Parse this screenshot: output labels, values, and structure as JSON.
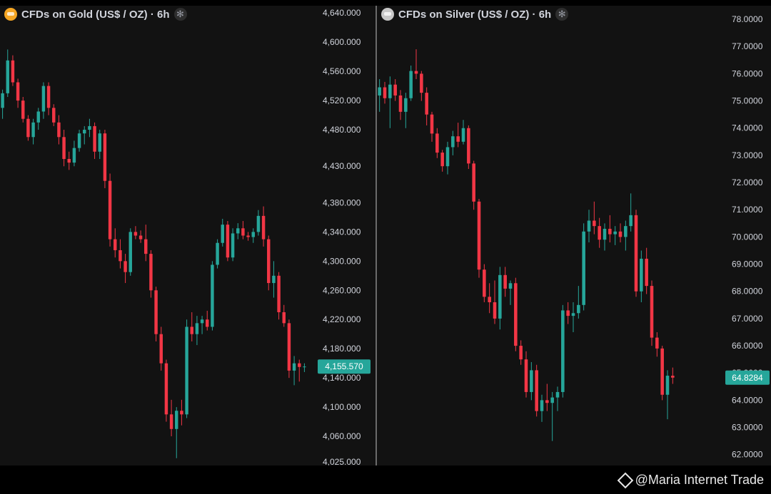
{
  "colors": {
    "up": "#26a69a",
    "down": "#f23645",
    "price_tag": "#26a69a",
    "background": "#121212"
  },
  "watermark": {
    "text": "@Maria Internet Trade",
    "icon": "binance-logo-icon"
  },
  "chart_data": [
    {
      "type": "candlestick",
      "title": "CFDs on Gold (US$ / OZ) · 6h",
      "icon": "gold-coin-icon",
      "yticks": [
        4025,
        4060,
        4100,
        4140,
        4180,
        4220,
        4260,
        4300,
        4340,
        4380,
        4430,
        4480,
        4520,
        4560,
        4600,
        4640
      ],
      "ytick_labels": [
        "4,025.000",
        "4,060.000",
        "4,100.000",
        "4,140.000",
        "4,180.000",
        "4,220.000",
        "4,260.000",
        "4,300.000",
        "4,340.000",
        "4,380.000",
        "4,430.000",
        "4,480.000",
        "4,520.000",
        "4,560.000",
        "4,600.000",
        "4,640.000"
      ],
      "ylim": [
        4020,
        4650
      ],
      "last_price": 4155.57,
      "last_price_label": "4,155.570",
      "ohlc": [
        [
          4510,
          4535,
          4495,
          4530
        ],
        [
          4530,
          4590,
          4525,
          4575
        ],
        [
          4575,
          4582,
          4540,
          4545
        ],
        [
          4545,
          4550,
          4510,
          4520
        ],
        [
          4520,
          4525,
          4490,
          4495
        ],
        [
          4495,
          4500,
          4465,
          4470
        ],
        [
          4470,
          4495,
          4460,
          4490
        ],
        [
          4490,
          4510,
          4480,
          4505
        ],
        [
          4505,
          4545,
          4495,
          4540
        ],
        [
          4540,
          4545,
          4500,
          4510
        ],
        [
          4510,
          4515,
          4485,
          4490
        ],
        [
          4490,
          4500,
          4460,
          4470
        ],
        [
          4470,
          4480,
          4430,
          4440
        ],
        [
          4440,
          4450,
          4425,
          4435
        ],
        [
          4435,
          4465,
          4430,
          4455
        ],
        [
          4455,
          4480,
          4450,
          4475
        ],
        [
          4475,
          4485,
          4460,
          4480
        ],
        [
          4480,
          4495,
          4470,
          4485
        ],
        [
          4485,
          4490,
          4440,
          4450
        ],
        [
          4450,
          4480,
          4440,
          4475
        ],
        [
          4475,
          4480,
          4400,
          4410
        ],
        [
          4410,
          4420,
          4320,
          4330
        ],
        [
          4330,
          4345,
          4305,
          4315
        ],
        [
          4315,
          4330,
          4290,
          4300
        ],
        [
          4300,
          4310,
          4270,
          4285
        ],
        [
          4285,
          4345,
          4280,
          4340
        ],
        [
          4340,
          4348,
          4330,
          4335
        ],
        [
          4335,
          4342,
          4325,
          4330
        ],
        [
          4330,
          4350,
          4300,
          4310
        ],
        [
          4310,
          4315,
          4250,
          4260
        ],
        [
          4260,
          4265,
          4190,
          4200
        ],
        [
          4200,
          4210,
          4150,
          4160
        ],
        [
          4160,
          4165,
          4080,
          4090
        ],
        [
          4090,
          4110,
          4060,
          4070
        ],
        [
          4070,
          4100,
          4030,
          4095
        ],
        [
          4095,
          4110,
          4075,
          4090
        ],
        [
          4090,
          4220,
          4085,
          4210
        ],
        [
          4210,
          4230,
          4190,
          4200
        ],
        [
          4200,
          4225,
          4185,
          4215
        ],
        [
          4215,
          4225,
          4200,
          4220
        ],
        [
          4220,
          4232,
          4205,
          4210
        ],
        [
          4210,
          4300,
          4205,
          4295
        ],
        [
          4295,
          4330,
          4290,
          4325
        ],
        [
          4325,
          4358,
          4320,
          4350
        ],
        [
          4350,
          4355,
          4300,
          4305
        ],
        [
          4305,
          4345,
          4300,
          4338
        ],
        [
          4338,
          4352,
          4330,
          4345
        ],
        [
          4345,
          4355,
          4330,
          4335
        ],
        [
          4335,
          4340,
          4328,
          4333
        ],
        [
          4333,
          4345,
          4325,
          4340
        ],
        [
          4340,
          4370,
          4335,
          4362
        ],
        [
          4362,
          4375,
          4320,
          4330
        ],
        [
          4330,
          4335,
          4260,
          4270
        ],
        [
          4270,
          4300,
          4250,
          4280
        ],
        [
          4280,
          4285,
          4220,
          4230
        ],
        [
          4230,
          4240,
          4210,
          4215
        ],
        [
          4215,
          4220,
          4140,
          4150
        ],
        [
          4150,
          4170,
          4130,
          4160
        ],
        [
          4160,
          4165,
          4135,
          4155
        ],
        [
          4155,
          4160,
          4148,
          4155.57
        ]
      ]
    },
    {
      "type": "candlestick",
      "title": "CFDs on Silver (US$ / OZ) · 6h",
      "icon": "silver-coin-icon",
      "yticks": [
        62,
        63,
        64,
        65,
        66,
        67,
        68,
        69,
        70,
        71,
        72,
        73,
        74,
        75,
        76,
        77,
        78
      ],
      "ytick_labels": [
        "62.0000",
        "63.0000",
        "64.0000",
        "65.0000",
        "66.0000",
        "67.0000",
        "68.0000",
        "69.0000",
        "70.0000",
        "71.0000",
        "72.0000",
        "73.0000",
        "74.0000",
        "75.0000",
        "76.0000",
        "77.0000",
        "78.0000"
      ],
      "ylim": [
        61.6,
        78.5
      ],
      "last_price": 64.8284,
      "last_price_label": "64.8284",
      "ohlc": [
        [
          75.2,
          75.8,
          74.6,
          75.5
        ],
        [
          75.5,
          75.7,
          74.9,
          75.1
        ],
        [
          75.1,
          75.9,
          74.0,
          75.6
        ],
        [
          75.6,
          75.8,
          75.0,
          75.2
        ],
        [
          75.2,
          75.4,
          74.3,
          74.6
        ],
        [
          74.6,
          75.3,
          74.0,
          75.1
        ],
        [
          75.1,
          76.3,
          75.0,
          76.1
        ],
        [
          76.1,
          76.9,
          75.8,
          76.0
        ],
        [
          76.0,
          76.1,
          75.0,
          75.3
        ],
        [
          75.3,
          75.5,
          74.1,
          74.5
        ],
        [
          74.5,
          74.6,
          73.5,
          73.8
        ],
        [
          73.8,
          74.0,
          72.9,
          73.1
        ],
        [
          73.1,
          73.2,
          72.4,
          72.6
        ],
        [
          72.6,
          73.5,
          72.3,
          73.3
        ],
        [
          73.3,
          73.9,
          73.0,
          73.7
        ],
        [
          73.7,
          74.2,
          73.3,
          73.5
        ],
        [
          73.5,
          74.3,
          73.4,
          74.0
        ],
        [
          74.0,
          74.1,
          72.5,
          72.7
        ],
        [
          72.7,
          72.8,
          71.0,
          71.3
        ],
        [
          71.3,
          71.4,
          68.5,
          68.8
        ],
        [
          68.8,
          69.0,
          67.6,
          67.8
        ],
        [
          67.8,
          68.3,
          67.2,
          67.6
        ],
        [
          67.6,
          68.4,
          66.8,
          67.0
        ],
        [
          67.0,
          68.9,
          66.6,
          68.6
        ],
        [
          68.6,
          68.9,
          67.8,
          68.1
        ],
        [
          68.1,
          68.4,
          67.5,
          68.3
        ],
        [
          68.3,
          68.5,
          65.8,
          66.0
        ],
        [
          66.0,
          66.2,
          65.3,
          65.5
        ],
        [
          65.5,
          65.8,
          64.1,
          64.3
        ],
        [
          64.3,
          65.4,
          64.0,
          65.1
        ],
        [
          65.1,
          65.3,
          63.4,
          63.6
        ],
        [
          63.6,
          64.2,
          63.2,
          64.0
        ],
        [
          64.0,
          64.6,
          63.6,
          63.9
        ],
        [
          63.9,
          64.3,
          62.5,
          64.1
        ],
        [
          64.1,
          64.5,
          63.6,
          64.3
        ],
        [
          64.3,
          67.5,
          64.1,
          67.3
        ],
        [
          67.3,
          67.6,
          66.8,
          67.1
        ],
        [
          67.1,
          67.6,
          66.5,
          67.2
        ],
        [
          67.2,
          68.2,
          67.0,
          67.5
        ],
        [
          67.5,
          70.5,
          67.3,
          70.2
        ],
        [
          70.2,
          71.0,
          69.8,
          70.6
        ],
        [
          70.6,
          71.3,
          70.1,
          70.4
        ],
        [
          70.4,
          70.7,
          69.6,
          69.9
        ],
        [
          69.9,
          70.5,
          69.5,
          70.3
        ],
        [
          70.3,
          70.8,
          69.8,
          70.1
        ],
        [
          70.1,
          70.4,
          69.7,
          70.2
        ],
        [
          70.2,
          70.5,
          69.8,
          70.0
        ],
        [
          70.0,
          70.6,
          69.5,
          70.4
        ],
        [
          70.4,
          71.6,
          70.2,
          70.8
        ],
        [
          70.8,
          71.0,
          67.8,
          68.0
        ],
        [
          68.0,
          69.5,
          67.6,
          69.2
        ],
        [
          69.2,
          69.6,
          67.9,
          68.2
        ],
        [
          68.2,
          68.4,
          66.0,
          66.3
        ],
        [
          66.3,
          66.5,
          65.6,
          65.9
        ],
        [
          65.9,
          66.0,
          64.0,
          64.2
        ],
        [
          64.2,
          65.1,
          63.3,
          64.9
        ],
        [
          64.9,
          65.2,
          64.6,
          64.8284
        ]
      ]
    }
  ]
}
